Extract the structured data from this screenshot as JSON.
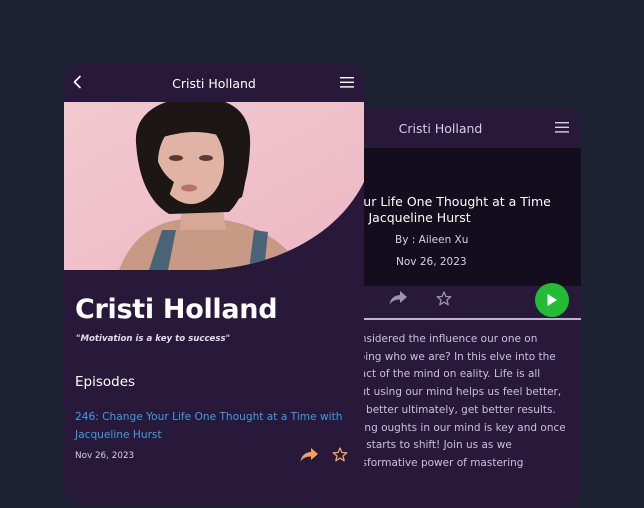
{
  "back_screen": {
    "header_title": "Cristi Holland",
    "episode_title": "e Your Life One Thought at a Time with Jacqueline Hurst",
    "author": "By : Aileen Xu",
    "date": "Nov 26, 2023",
    "description": "r considered the influence our one on shaping who we are? In this elve into the impact of the mind on eality. Life is all about using our mind helps us feel better, take better ultimately, get better results. Finding oughts in our mind is key and once hing starts to shift! Join us as we transformative power of mastering"
  },
  "front_screen": {
    "header_title": "Cristi Holland",
    "name": "Cristi Holland",
    "tagline": "\"Motivation is a key to success\"",
    "episodes_heading": "Episodes",
    "episode": {
      "title": "246: Change Your Life One Thought at a Time with Jacqueline Hurst",
      "date": "Nov 26, 2023"
    }
  },
  "colors": {
    "page_background": "#1c2232",
    "card_background": "#28193a",
    "link": "#3d9de3",
    "accent_orange": "#f3a25c",
    "play_green": "#23bd35"
  },
  "icons": [
    "back-arrow-icon",
    "menu-icon",
    "share-icon",
    "star-icon",
    "play-icon"
  ]
}
